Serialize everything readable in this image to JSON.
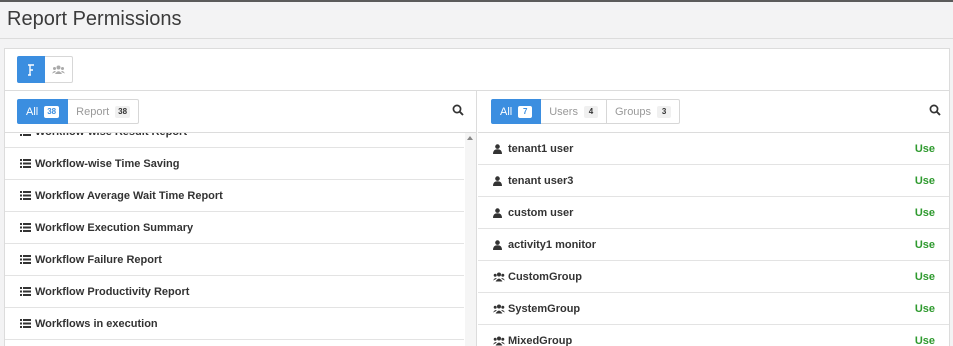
{
  "page": {
    "title": "Report Permissions"
  },
  "view_toggle": [
    {
      "icon": "reports-view-icon",
      "active": true
    },
    {
      "icon": "groups-view-icon",
      "active": false
    }
  ],
  "reports_panel": {
    "filters": [
      {
        "label": "All",
        "count": "38",
        "active": true
      },
      {
        "label": "Report",
        "count": "38",
        "active": false
      }
    ],
    "search_icon": "search-icon",
    "items": [
      {
        "label": "Workflow-wise Result Report",
        "icon": "list-icon"
      },
      {
        "label": "Workflow-wise Time Saving",
        "icon": "list-icon"
      },
      {
        "label": "Workflow Average Wait Time Report",
        "icon": "list-icon"
      },
      {
        "label": "Workflow Execution Summary",
        "icon": "list-icon"
      },
      {
        "label": "Workflow Failure Report",
        "icon": "list-icon"
      },
      {
        "label": "Workflow Productivity Report",
        "icon": "list-icon"
      },
      {
        "label": "Workflows in execution",
        "icon": "list-icon"
      }
    ]
  },
  "principals_panel": {
    "filters": [
      {
        "label": "All",
        "count": "7",
        "active": true
      },
      {
        "label": "Users",
        "count": "4",
        "active": false
      },
      {
        "label": "Groups",
        "count": "3",
        "active": false
      }
    ],
    "search_icon": "search-icon",
    "items": [
      {
        "label": "tenant1 user",
        "type": "user",
        "icon": "user-icon",
        "permission": "Use"
      },
      {
        "label": "tenant user3",
        "type": "user",
        "icon": "user-icon",
        "permission": "Use"
      },
      {
        "label": "custom user",
        "type": "user",
        "icon": "user-icon",
        "permission": "Use"
      },
      {
        "label": "activity1 monitor",
        "type": "user",
        "icon": "user-icon",
        "permission": "Use"
      },
      {
        "label": "CustomGroup",
        "type": "group",
        "icon": "group-icon",
        "permission": "Use"
      },
      {
        "label": "SystemGroup",
        "type": "group",
        "icon": "group-icon",
        "permission": "Use"
      },
      {
        "label": "MixedGroup",
        "type": "group",
        "icon": "group-icon",
        "permission": "Use"
      }
    ]
  },
  "colors": {
    "accent": "#3b8ee0",
    "permission": "#2f9a2f"
  }
}
